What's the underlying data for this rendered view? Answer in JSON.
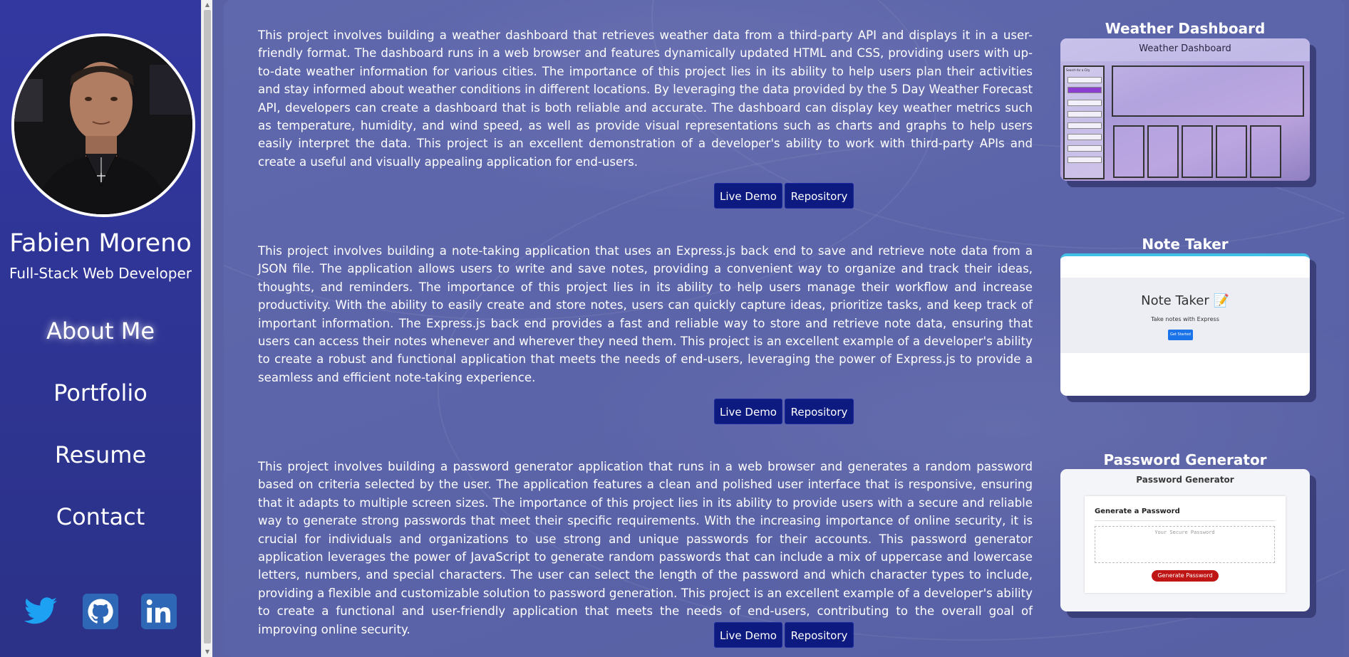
{
  "profile": {
    "name": "Fabien Moreno",
    "role": "Full-Stack Web Developer"
  },
  "nav": [
    {
      "label": "About Me",
      "active": true
    },
    {
      "label": "Portfolio",
      "active": false
    },
    {
      "label": "Resume",
      "active": false
    },
    {
      "label": "Contact",
      "active": false
    }
  ],
  "socials": [
    {
      "icon": "twitter-icon",
      "color": "#1da1f2"
    },
    {
      "icon": "github-icon",
      "color": "#2e67b5"
    },
    {
      "icon": "linkedin-icon",
      "color": "#2e67b5"
    }
  ],
  "projects": [
    {
      "title": "Weather Dashboard",
      "description": "This project involves building a weather dashboard that retrieves weather data from a third-party API and displays it in a user-friendly format. The dashboard runs in a web browser and features dynamically updated HTML and CSS, providing users with up-to-date weather information for various cities. The importance of this project lies in its ability to help users plan their activities and stay informed about weather conditions in different locations. By leveraging the data provided by the 5 Day Weather Forecast API, developers can create a dashboard that is both reliable and accurate. The dashboard can display key weather metrics such as temperature, humidity, and wind speed, as well as provide visual representations such as charts and graphs to help users easily interpret the data. This project is an excellent demonstration of a developer's ability to work with third-party APIs and create a useful and visually appealing application for end-users.",
      "demo_label": "Live Demo",
      "repo_label": "Repository",
      "preview": {
        "header": "Weather Dashboard",
        "sidebar_label": "Search for a City"
      }
    },
    {
      "title": "Note Taker",
      "description": "This project involves building a note-taking application that uses an Express.js back end to save and retrieve note data from a JSON file. The application allows users to write and save notes, providing a convenient way to organize and track their ideas, thoughts, and reminders. The importance of this project lies in its ability to help users manage their workflow and increase productivity. With the ability to easily create and store notes, users can quickly capture ideas, prioritize tasks, and keep track of important information. The Express.js back end provides a fast and reliable way to store and retrieve note data, ensuring that users can access their notes whenever and wherever they need them. This project is an excellent example of a developer's ability to create a robust and functional application that meets the needs of end-users, leveraging the power of Express.js to provide a seamless and efficient note-taking experience.",
      "demo_label": "Live Demo",
      "repo_label": "Repository",
      "preview": {
        "header": "Note Taker 📝",
        "subtitle": "Take notes with Express",
        "button": "Get Started"
      }
    },
    {
      "title": "Password Generator",
      "description": "This project involves building a password generator application that runs in a web browser and generates a random password based on criteria selected by the user. The application features a clean and polished user interface that is responsive, ensuring that it adapts to multiple screen sizes. The importance of this project lies in its ability to provide users with a secure and reliable way to generate strong passwords that meet their specific requirements. With the increasing importance of online security, it is crucial for individuals and organizations to use strong and unique passwords for their accounts. This password generator application leverages the power of JavaScript to generate random passwords that can include a mix of uppercase and lowercase letters, numbers, and special characters. The user can select the length of the password and which character types to include, providing a flexible and customizable solution to password generation. This project is an excellent example of a developer's ability to create a functional and user-friendly application that meets the needs of end-users, contributing to the overall goal of improving online security.",
      "demo_label": "Live Demo",
      "repo_label": "Repository",
      "preview": {
        "header": "Password Generator",
        "label": "Generate a Password",
        "placeholder": "Your Secure Password",
        "button": "Generate Password"
      }
    }
  ]
}
